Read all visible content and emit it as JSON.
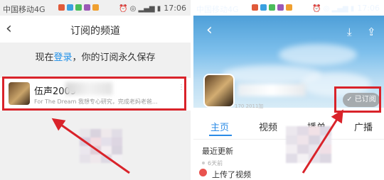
{
  "left_screen": {
    "status": {
      "carrier": "中国移动4G",
      "time": "17:06"
    },
    "title": "订阅的频道",
    "login_prompt": {
      "prefix": "现在",
      "link": "登录",
      "suffix": "，你的订阅永久保存"
    },
    "channel": {
      "name": "伍声2009",
      "description": "For The Dream 我想专心研究，完成老妈老爸..."
    }
  },
  "right_screen": {
    "status": {
      "carrier": "中国移动4G",
      "time": "17:06"
    },
    "subscribed_button": "✓ 已订阅",
    "channel_meta": "170  2011加",
    "tabs": [
      {
        "label": "主页",
        "active": true
      },
      {
        "label": "视频",
        "active": false
      },
      {
        "label": "播单",
        "active": false
      },
      {
        "label": "广播",
        "active": false
      }
    ],
    "recent_heading": "最近更新",
    "recent_time": "6天前",
    "recent_action": "上传了视频"
  },
  "colors": {
    "accent": "#2b8be6",
    "highlight": "#d9232a",
    "link": "#1e8fe8"
  },
  "icons": [
    "back-icon",
    "share-icon",
    "download-icon",
    "more-icon",
    "upload-icon"
  ]
}
